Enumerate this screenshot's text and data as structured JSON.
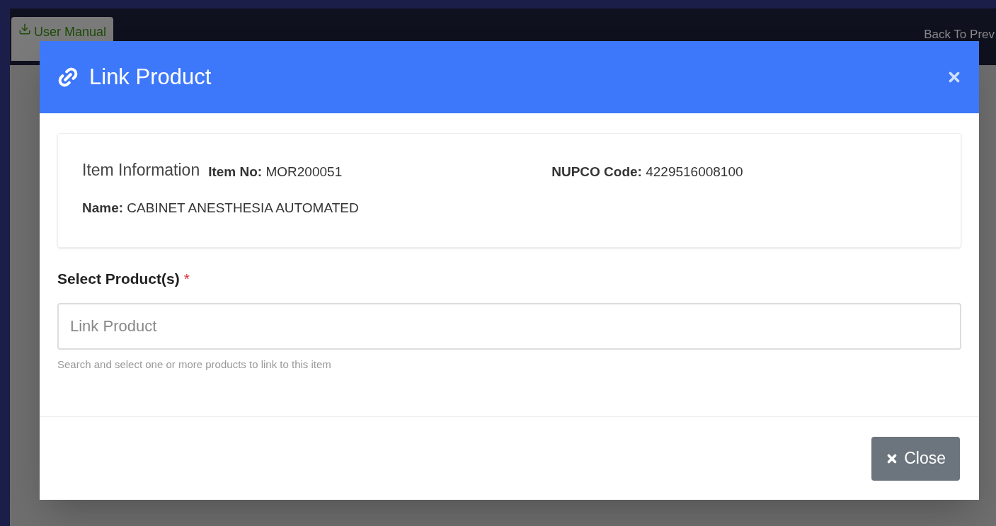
{
  "background": {
    "user_manual_button": "User Manual",
    "back_link": "Back To Prev"
  },
  "modal": {
    "title": "Link Product",
    "item_info": {
      "heading": "Item Information",
      "fields": [
        {
          "label": "Item No:",
          "value": "MOR200051"
        },
        {
          "label": "NUPCO Code:",
          "value": "4229516008100"
        },
        {
          "label": "Name:",
          "value": "CABINET ANESTHESIA AUTOMATED"
        }
      ]
    },
    "select_label": "Select Product(s)",
    "required": true,
    "required_mark": "*",
    "field": {
      "placeholder": "Link Product"
    },
    "help_text": "Search and select one or more products to link to this item",
    "close_button": "Close"
  }
}
